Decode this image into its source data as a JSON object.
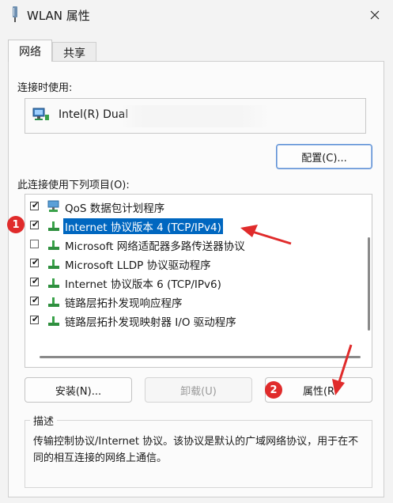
{
  "window": {
    "title": "WLAN 属性"
  },
  "tabs": [
    {
      "label": "网络",
      "active": true
    },
    {
      "label": "共享",
      "active": false
    }
  ],
  "connect_using": {
    "label": "连接时使用:",
    "adapter_name": "Intel(R) Dual",
    "configure_button": "配置(C)..."
  },
  "items_label": "此连接使用下列项目(O):",
  "items": [
    {
      "label": "QoS 数据包计划程序",
      "checked": true,
      "selected": false,
      "icon": "qos-scheduler-icon"
    },
    {
      "label": "Internet 协议版本 4 (TCP/IPv4)",
      "checked": true,
      "selected": true,
      "icon": "network-protocol-icon"
    },
    {
      "label": "Microsoft 网络适配器多路传送器协议",
      "checked": false,
      "selected": false,
      "icon": "network-protocol-icon"
    },
    {
      "label": "Microsoft LLDP 协议驱动程序",
      "checked": true,
      "selected": false,
      "icon": "network-protocol-icon"
    },
    {
      "label": "Internet 协议版本 6 (TCP/IPv6)",
      "checked": true,
      "selected": false,
      "icon": "network-protocol-icon"
    },
    {
      "label": "链路层拓扑发现响应程序",
      "checked": true,
      "selected": false,
      "icon": "network-protocol-icon"
    },
    {
      "label": "链路层拓扑发现映射器 I/O 驱动程序",
      "checked": true,
      "selected": false,
      "icon": "network-protocol-icon"
    }
  ],
  "buttons": {
    "install": "安装(N)...",
    "uninstall": "卸载(U)",
    "properties": "属性(R"
  },
  "description": {
    "legend": "描述",
    "text": "传输控制协议/Internet 协议。该协议是默认的广域网络协议，用于在不同的相互连接的网络上通信。"
  },
  "annotations": {
    "badge1": "1",
    "badge2": "2",
    "color": "#e02b2b"
  },
  "colors": {
    "selection": "#0067c0",
    "accent_border": "#5b8fd6"
  }
}
